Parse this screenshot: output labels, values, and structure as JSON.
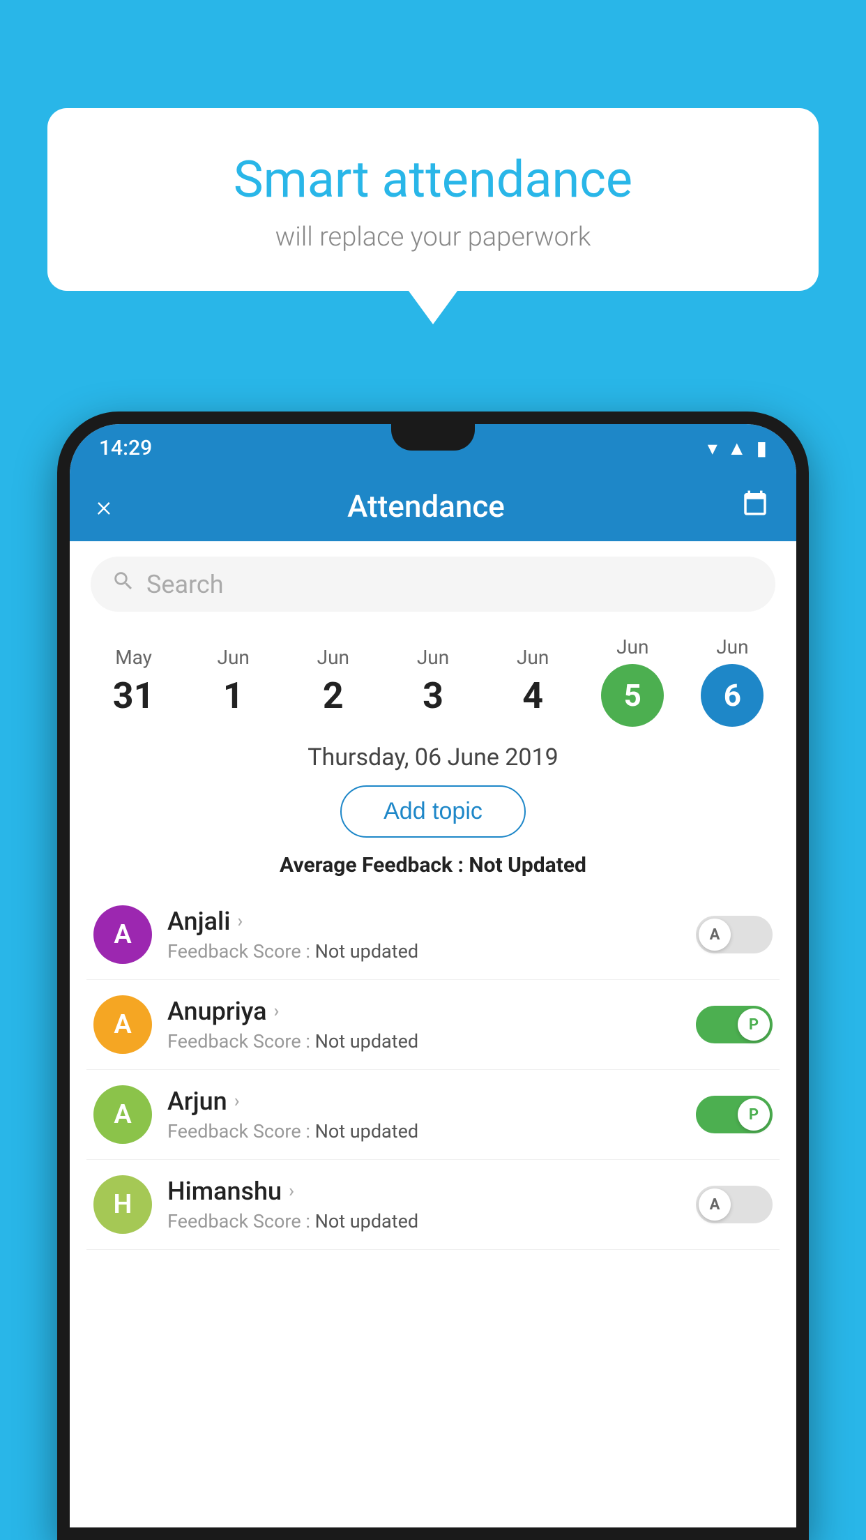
{
  "background_color": "#29b6e8",
  "bubble": {
    "title": "Smart attendance",
    "subtitle": "will replace your paperwork"
  },
  "status_bar": {
    "time": "14:29"
  },
  "header": {
    "title": "Attendance",
    "close_label": "×",
    "calendar_label": "📅"
  },
  "search": {
    "placeholder": "Search"
  },
  "dates": [
    {
      "month": "May",
      "day": "31",
      "active": ""
    },
    {
      "month": "Jun",
      "day": "1",
      "active": ""
    },
    {
      "month": "Jun",
      "day": "2",
      "active": ""
    },
    {
      "month": "Jun",
      "day": "3",
      "active": ""
    },
    {
      "month": "Jun",
      "day": "4",
      "active": ""
    },
    {
      "month": "Jun",
      "day": "5",
      "active": "green"
    },
    {
      "month": "Jun",
      "day": "6",
      "active": "blue"
    }
  ],
  "selected_date": "Thursday, 06 June 2019",
  "add_topic": "Add topic",
  "avg_feedback_label": "Average Feedback : ",
  "avg_feedback_value": "Not Updated",
  "students": [
    {
      "name": "Anjali",
      "avatar_letter": "A",
      "avatar_color": "#9c27b0",
      "feedback": "Not updated",
      "toggle": "off",
      "toggle_letter": "A"
    },
    {
      "name": "Anupriya",
      "avatar_letter": "A",
      "avatar_color": "#f5a623",
      "feedback": "Not updated",
      "toggle": "on",
      "toggle_letter": "P"
    },
    {
      "name": "Arjun",
      "avatar_letter": "A",
      "avatar_color": "#8bc34a",
      "feedback": "Not updated",
      "toggle": "on",
      "toggle_letter": "P"
    },
    {
      "name": "Himanshu",
      "avatar_letter": "H",
      "avatar_color": "#a5c855",
      "feedback": "Not updated",
      "toggle": "off",
      "toggle_letter": "A"
    }
  ]
}
